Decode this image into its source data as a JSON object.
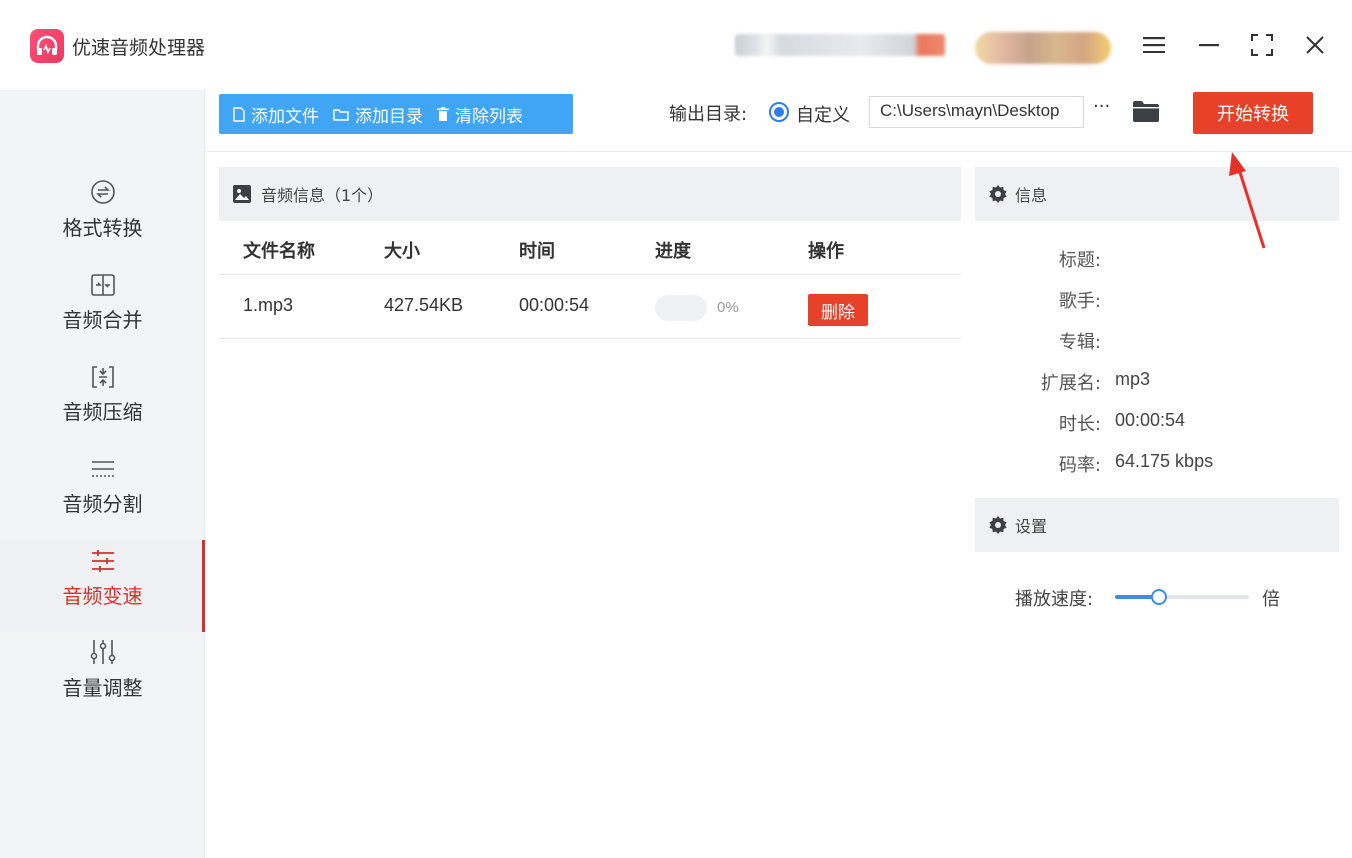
{
  "app": {
    "title": "优速音频处理器",
    "logo_icon": "headphones-icon",
    "accent_color": "#e8412a"
  },
  "window_controls": {
    "menu": "≡",
    "minimize": "—",
    "maximize": "⛶",
    "close": "✕"
  },
  "sidebar": {
    "items": [
      {
        "label": "格式转换",
        "icon": "convert-icon",
        "active": false
      },
      {
        "label": "音频合并",
        "icon": "merge-icon",
        "active": false
      },
      {
        "label": "音频压缩",
        "icon": "compress-icon",
        "active": false
      },
      {
        "label": "音频分割",
        "icon": "split-icon",
        "active": false
      },
      {
        "label": "音频变速",
        "icon": "speed-icon",
        "active": true
      },
      {
        "label": "音量调整",
        "icon": "volume-icon",
        "active": false
      }
    ]
  },
  "toolbar": {
    "add_file": "添加文件",
    "add_dir": "添加目录",
    "clear_list": "清除列表",
    "output_label": "输出目录:",
    "output_option": "自定义",
    "output_path": "C:\\Users\\mayn\\Desktop",
    "more": "···",
    "start": "开始转换"
  },
  "file_list": {
    "header": "音频信息（1个）",
    "columns": [
      "文件名称",
      "大小",
      "时间",
      "进度",
      "操作"
    ],
    "rows": [
      {
        "name": "1.mp3",
        "size": "427.54KB",
        "duration": "00:00:54",
        "progress_text": "0%",
        "progress": 0,
        "action": "删除"
      }
    ]
  },
  "info": {
    "header": "信息",
    "fields": [
      {
        "key": "标题:",
        "value": ""
      },
      {
        "key": "歌手:",
        "value": ""
      },
      {
        "key": "专辑:",
        "value": ""
      },
      {
        "key": "扩展名:",
        "value": "mp3"
      },
      {
        "key": "时长:",
        "value": "00:00:54"
      },
      {
        "key": "码率:",
        "value": "64.175 kbps"
      }
    ]
  },
  "settings": {
    "header": "设置",
    "speed_label": "播放速度:",
    "speed_unit": "倍",
    "speed_level": 0.33
  }
}
